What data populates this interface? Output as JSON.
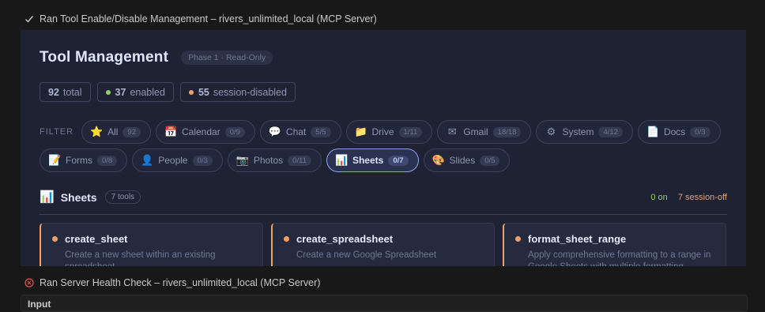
{
  "runs": [
    {
      "status": "success",
      "text": "Ran Tool Enable/Disable Management – rivers_unlimited_local (MCP Server)"
    },
    {
      "status": "error",
      "text": "Ran Server Health Check – rivers_unlimited_local (MCP Server)"
    }
  ],
  "panel": {
    "title": "Tool Management",
    "phase_badge": "Phase 1 · Read-Only",
    "stats": {
      "total_num": "92",
      "total_label": "total",
      "enabled_num": "37",
      "enabled_label": "enabled",
      "disabled_num": "55",
      "disabled_label": "session-disabled"
    },
    "filter_label": "FILTER",
    "filters": [
      {
        "icon": "⭐",
        "label": "All",
        "count": "92"
      },
      {
        "icon": "📅",
        "label": "Calendar",
        "count": "0/9"
      },
      {
        "icon": "💬",
        "label": "Chat",
        "count": "5/5"
      },
      {
        "icon": "📁",
        "label": "Drive",
        "count": "1/11"
      },
      {
        "icon": "✉",
        "label": "Gmail",
        "count": "18/18"
      },
      {
        "icon": "⚙",
        "label": "System",
        "count": "4/12"
      },
      {
        "icon": "📄",
        "label": "Docs",
        "count": "0/3"
      },
      {
        "icon": "📝",
        "label": "Forms",
        "count": "0/8"
      },
      {
        "icon": "👤",
        "label": "People",
        "count": "0/3"
      },
      {
        "icon": "📷",
        "label": "Photos",
        "count": "0/11"
      },
      {
        "icon": "📊",
        "label": "Sheets",
        "count": "0/7",
        "active": true
      },
      {
        "icon": "🎨",
        "label": "Slides",
        "count": "0/5"
      }
    ],
    "section": {
      "icon": "📊",
      "title": "Sheets",
      "tools_badge": "7 tools",
      "on_text": "0 on",
      "off_text": "7 session-off"
    },
    "cards": [
      {
        "name": "create_sheet",
        "desc": "Create a new sheet within an existing spreadsheet"
      },
      {
        "name": "create_spreadsheet",
        "desc": "Create a new Google Spreadsheet"
      },
      {
        "name": "format_sheet_range",
        "desc": "Apply comprehensive formatting to a range in Google Sheets with multiple formatting"
      }
    ]
  },
  "input_box": {
    "label": "Input"
  },
  "colors": {
    "enabled_dot": "#8fd16a",
    "disabled_dot": "#f0a068",
    "accent": "#8ea4f0",
    "success": "#cccccc",
    "error": "#e0554e"
  }
}
